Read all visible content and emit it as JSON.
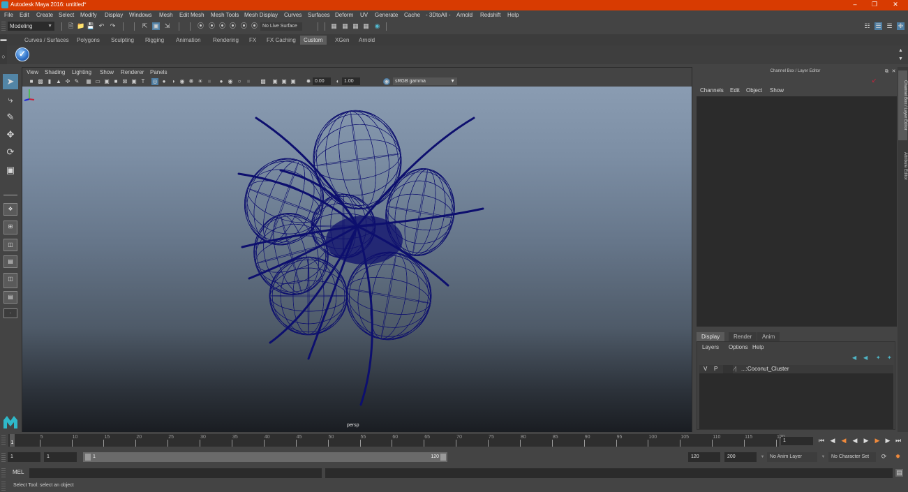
{
  "window": {
    "title": "Autodesk Maya 2016: untitled*",
    "controls": [
      "minimize",
      "restore",
      "close"
    ],
    "accent": "#d83b01"
  },
  "menubar": [
    "File",
    "Edit",
    "Create",
    "Select",
    "Modify",
    "Display",
    "Windows",
    "Mesh",
    "Edit Mesh",
    "Mesh Tools",
    "Mesh Display",
    "Curves",
    "Surfaces",
    "Deform",
    "UV",
    "Generate",
    "Cache",
    "- 3DtoAll -",
    "Arnold",
    "Redshift",
    "Help"
  ],
  "statusline": {
    "mode": "Modeling",
    "live_surface": "No Live Surface"
  },
  "shelf": {
    "tabs": [
      "Curves / Surfaces",
      "Polygons",
      "Sculpting",
      "Rigging",
      "Animation",
      "Rendering",
      "FX",
      "FX Caching",
      "Custom",
      "XGen",
      "Arnold"
    ],
    "active_tab": "Custom",
    "buttons": [
      "checkmark-shelf-tool"
    ]
  },
  "toolbox": [
    "select-tool",
    "lasso-tool",
    "paint-select-tool",
    "move-tool",
    "rotate-tool",
    "scale-tool"
  ],
  "viewport": {
    "menu": [
      "View",
      "Shading",
      "Lighting",
      "Show",
      "Renderer",
      "Panels"
    ],
    "exposure": "0.00",
    "gamma": "1.00",
    "color_space": "sRGB gamma",
    "camera_label": "persp",
    "object_color": "#0d0f6e"
  },
  "channel_box": {
    "title": "Channel Box / Layer Editor",
    "menu": [
      "Channels",
      "Edit",
      "Object",
      "Show"
    ]
  },
  "layer_editor": {
    "tabs": [
      "Display",
      "Render",
      "Anim"
    ],
    "active_tab": "Display",
    "menu": [
      "Layers",
      "Options",
      "Help"
    ],
    "layers": [
      {
        "visible": "V",
        "playback": "P",
        "name": "...:Coconut_Cluster"
      }
    ]
  },
  "side_tabs": [
    "Channel Box / Layer Editor",
    "Attribute Editor"
  ],
  "timeline": {
    "ticks": [
      5,
      10,
      15,
      20,
      25,
      30,
      35,
      40,
      45,
      50,
      55,
      60,
      65,
      70,
      75,
      80,
      85,
      90,
      95,
      100,
      105,
      110,
      115,
      120
    ],
    "start": 1,
    "end": 120,
    "current_frame_marker": "1",
    "current_frame": "1"
  },
  "range": {
    "start_time": "1",
    "playback_start": "1",
    "slider_start": "1",
    "slider_end": "120",
    "playback_end": "120",
    "end_time": "200",
    "anim_layer": "No Anim Layer",
    "character_set": "No Character Set"
  },
  "cmdline": {
    "label": "MEL"
  },
  "help_line": "Select Tool: select an object"
}
